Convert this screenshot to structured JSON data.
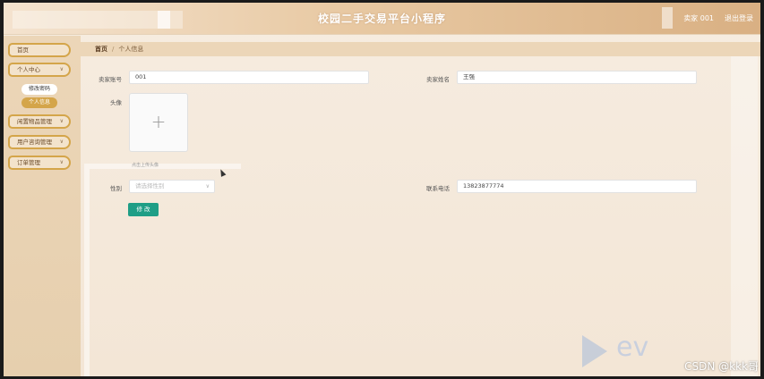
{
  "header": {
    "title": "校园二手交易平台小程序",
    "user": "卖家 001",
    "logout": "退出登录"
  },
  "sidebar": {
    "items": [
      {
        "label": "首页"
      },
      {
        "label": "个人中心",
        "expanded": true,
        "children": [
          {
            "label": "修改密码"
          },
          {
            "label": "个人信息",
            "active": true
          }
        ]
      },
      {
        "label": "闲置物品管理"
      },
      {
        "label": "用户咨询管理"
      },
      {
        "label": "订单管理"
      }
    ]
  },
  "breadcrumb": {
    "home": "首页",
    "separator": "/",
    "current": "个人信息"
  },
  "form": {
    "seller_account": {
      "label": "卖家账号",
      "value": "001"
    },
    "seller_name": {
      "label": "卖家姓名",
      "value": "王强"
    },
    "avatar": {
      "label": "头像",
      "tip": "点击上传头像"
    },
    "gender": {
      "label": "性别",
      "placeholder": "请选择性别"
    },
    "phone": {
      "label": "联系电话",
      "value": "13823877774"
    },
    "submit": "修 改"
  },
  "watermark": {
    "brand": "ev",
    "csdn": "CSDN @kkk哥"
  },
  "icons": {
    "chevron": "chevron-down-icon",
    "plus": "plus-icon",
    "cursor": "mouse-cursor-icon"
  }
}
